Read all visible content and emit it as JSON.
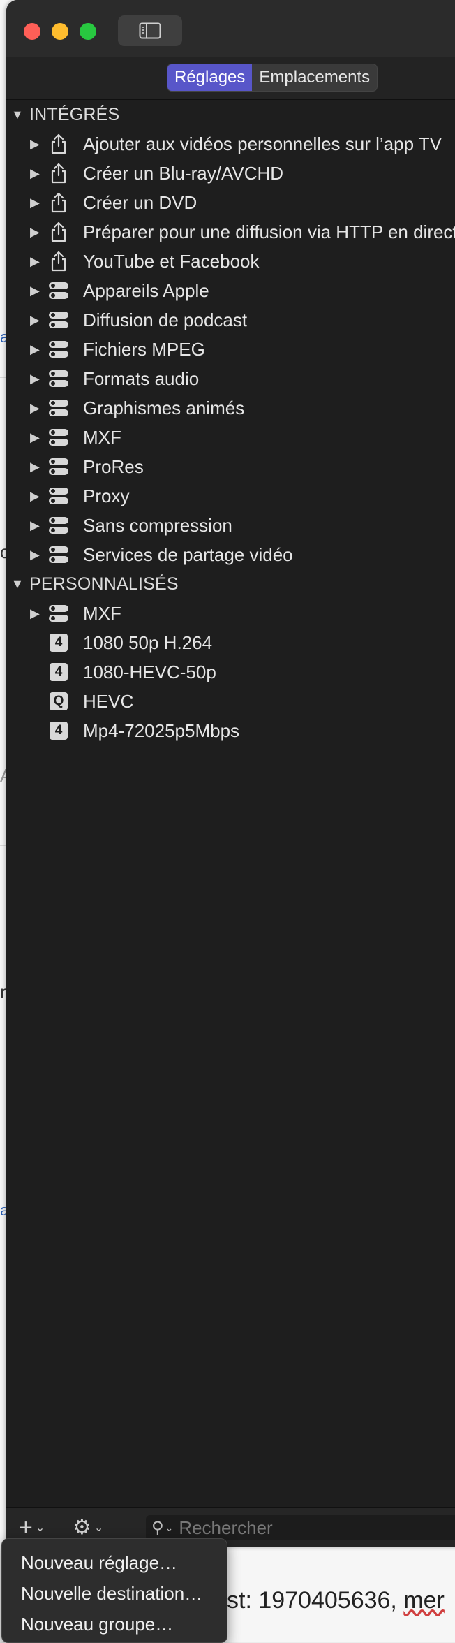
{
  "window": {
    "traffic_lights": {
      "close": "#ff5f57",
      "minimize": "#febc2e",
      "zoom": "#28c840"
    },
    "sidebar_toggle_icon": "sidebar-icon"
  },
  "segmented": {
    "tabs": [
      {
        "label": "Réglages",
        "active": true
      },
      {
        "label": "Emplacements",
        "active": false
      }
    ]
  },
  "groups": [
    {
      "label": "INTÉGRÉS"
    },
    {
      "label": "PERSONNALISÉS"
    }
  ],
  "builtin_items": [
    {
      "label": "Ajouter aux vidéos personnelles sur l’app TV",
      "icon": "share-icon"
    },
    {
      "label": "Créer un Blu-ray/AVCHD",
      "icon": "share-icon"
    },
    {
      "label": "Créer un DVD",
      "icon": "share-icon"
    },
    {
      "label": "Préparer pour une diffusion via HTTP en direct",
      "icon": "share-icon"
    },
    {
      "label": "YouTube et Facebook",
      "icon": "share-icon"
    },
    {
      "label": "Appareils Apple",
      "icon": "settings-group-icon"
    },
    {
      "label": "Diffusion de podcast",
      "icon": "settings-group-icon"
    },
    {
      "label": "Fichiers MPEG",
      "icon": "settings-group-icon"
    },
    {
      "label": "Formats audio",
      "icon": "settings-group-icon"
    },
    {
      "label": "Graphismes animés",
      "icon": "settings-group-icon"
    },
    {
      "label": "MXF",
      "icon": "settings-group-icon"
    },
    {
      "label": "ProRes",
      "icon": "settings-group-icon"
    },
    {
      "label": "Proxy",
      "icon": "settings-group-icon"
    },
    {
      "label": "Sans compression",
      "icon": "settings-group-icon"
    },
    {
      "label": "Services de partage vidéo",
      "icon": "settings-group-icon"
    }
  ],
  "custom_items": [
    {
      "label": "MXF",
      "icon": "settings-group-icon",
      "badge": ""
    },
    {
      "label": "1080 50p H.264",
      "icon": "h264-badge-icon",
      "badge": "4"
    },
    {
      "label": "1080-HEVC-50p",
      "icon": "h264-badge-icon",
      "badge": "4"
    },
    {
      "label": "HEVC",
      "icon": "quicktime-badge-icon",
      "badge": "Q"
    },
    {
      "label": "Mp4-72025p5Mbps",
      "icon": "h264-badge-icon",
      "badge": "4"
    }
  ],
  "bottom_bar": {
    "add_icon": "plus-icon",
    "action_icon": "gear-icon",
    "search_placeholder": "Rechercher"
  },
  "add_menu": {
    "items": [
      "Nouveau réglage…",
      "Nouvelle destination…",
      "Nouveau groupe…"
    ]
  },
  "background": {
    "fragments": [
      "a",
      "o",
      "A",
      "n",
      "a"
    ],
    "bottom_text_prefix": "st: 1970405636, ",
    "bottom_text_flagged": "mer"
  }
}
